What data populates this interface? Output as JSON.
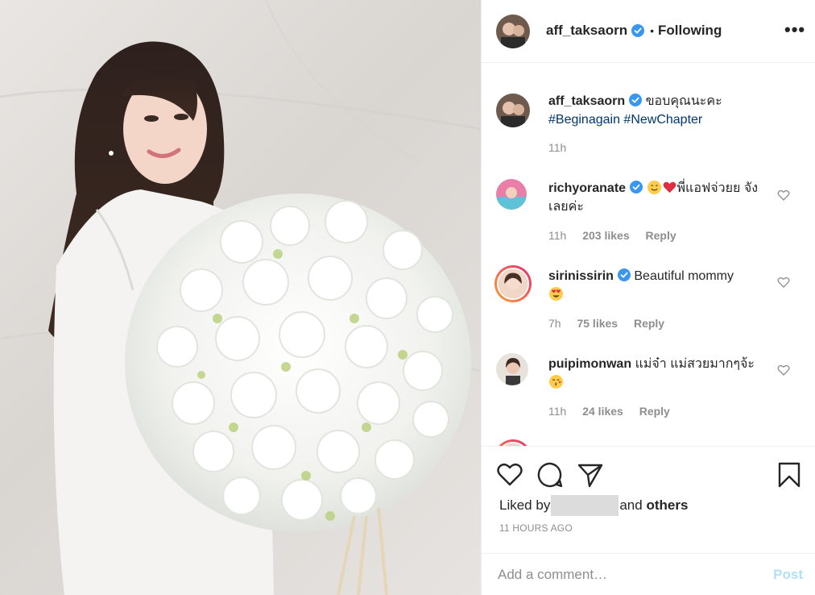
{
  "post": {
    "image_alt": "Woman in white suit holding a large bouquet of white flowers"
  },
  "header": {
    "username": "aff_taksaorn",
    "separator": "•",
    "follow_status": "Following",
    "more_label": "•••"
  },
  "caption": {
    "username": "aff_taksaorn",
    "text": "ขอบคุณนะคะ",
    "hashtags": "#Beginagain #NewChapter",
    "time": "11h"
  },
  "comments": [
    {
      "username": "richyoranate",
      "verified": true,
      "text": "พี่แอฟจ่วยย จังเลยค่ะ",
      "time": "11h",
      "likes": "203 likes",
      "reply": "Reply",
      "emoji": [
        "grin-face",
        "red-heart"
      ]
    },
    {
      "username": "sirinissirin",
      "verified": true,
      "text": "Beautiful mommy",
      "time": "7h",
      "likes": "75 likes",
      "reply": "Reply",
      "emoji": [
        "heart-eyes-face"
      ]
    },
    {
      "username": "puipimonwan",
      "verified": false,
      "text": "แม่จ๋า แม่สวยมากๆจ้ะ",
      "time": "11h",
      "likes": "24 likes",
      "reply": "Reply",
      "emoji": [
        "kiss-face"
      ]
    }
  ],
  "actions": {
    "icons": [
      "heart-icon",
      "comment-icon",
      "share-icon",
      "bookmark-icon"
    ],
    "liked_by_prefix": "Liked by",
    "liked_by_suffix": "and",
    "liked_by_others": "others",
    "timestamp": "11 HOURS AGO"
  },
  "add_comment": {
    "placeholder": "Add a comment…",
    "post_label": "Post"
  },
  "colors": {
    "verified_blue": "#3897f0",
    "link": "#00376b",
    "muted": "#8e8e8e",
    "post_disabled": "#b2dffc"
  }
}
